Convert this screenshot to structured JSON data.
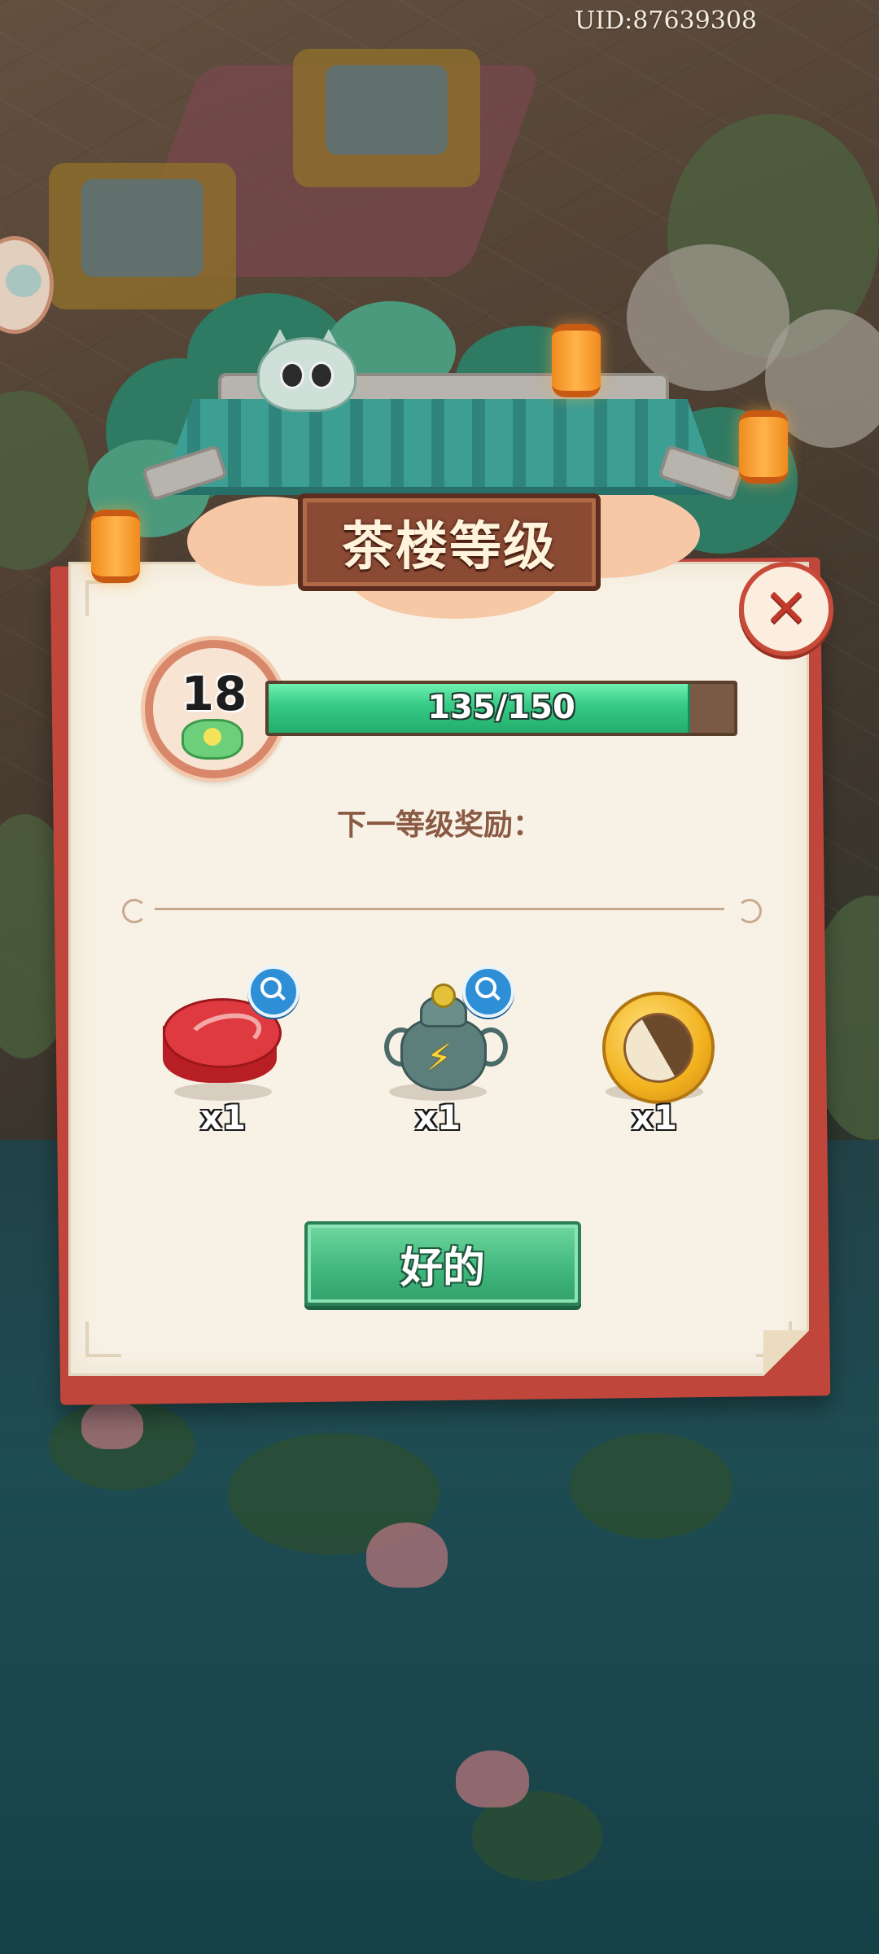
{
  "status": {
    "uid": "UID:87639308"
  },
  "dialog": {
    "title": "茶楼等级",
    "close_icon": "close-icon",
    "level": {
      "current": "18",
      "progress_text": "135/150",
      "progress_fraction": 0.9
    },
    "rewards_label": "下一等级奖励：",
    "rewards": [
      {
        "icon": "red-tin-box-icon",
        "qty": "x1",
        "has_magnifier": true
      },
      {
        "icon": "incense-burner-icon",
        "qty": "x1",
        "has_magnifier": true
      },
      {
        "icon": "yin-yang-coin-icon",
        "qty": "x1",
        "has_magnifier": false
      }
    ],
    "ok_label": "好的"
  },
  "colors": {
    "accent_green": "#3fb67c",
    "paper": "#f8f2e6",
    "frame_red": "#c0463b",
    "close_red": "#c0392b"
  }
}
